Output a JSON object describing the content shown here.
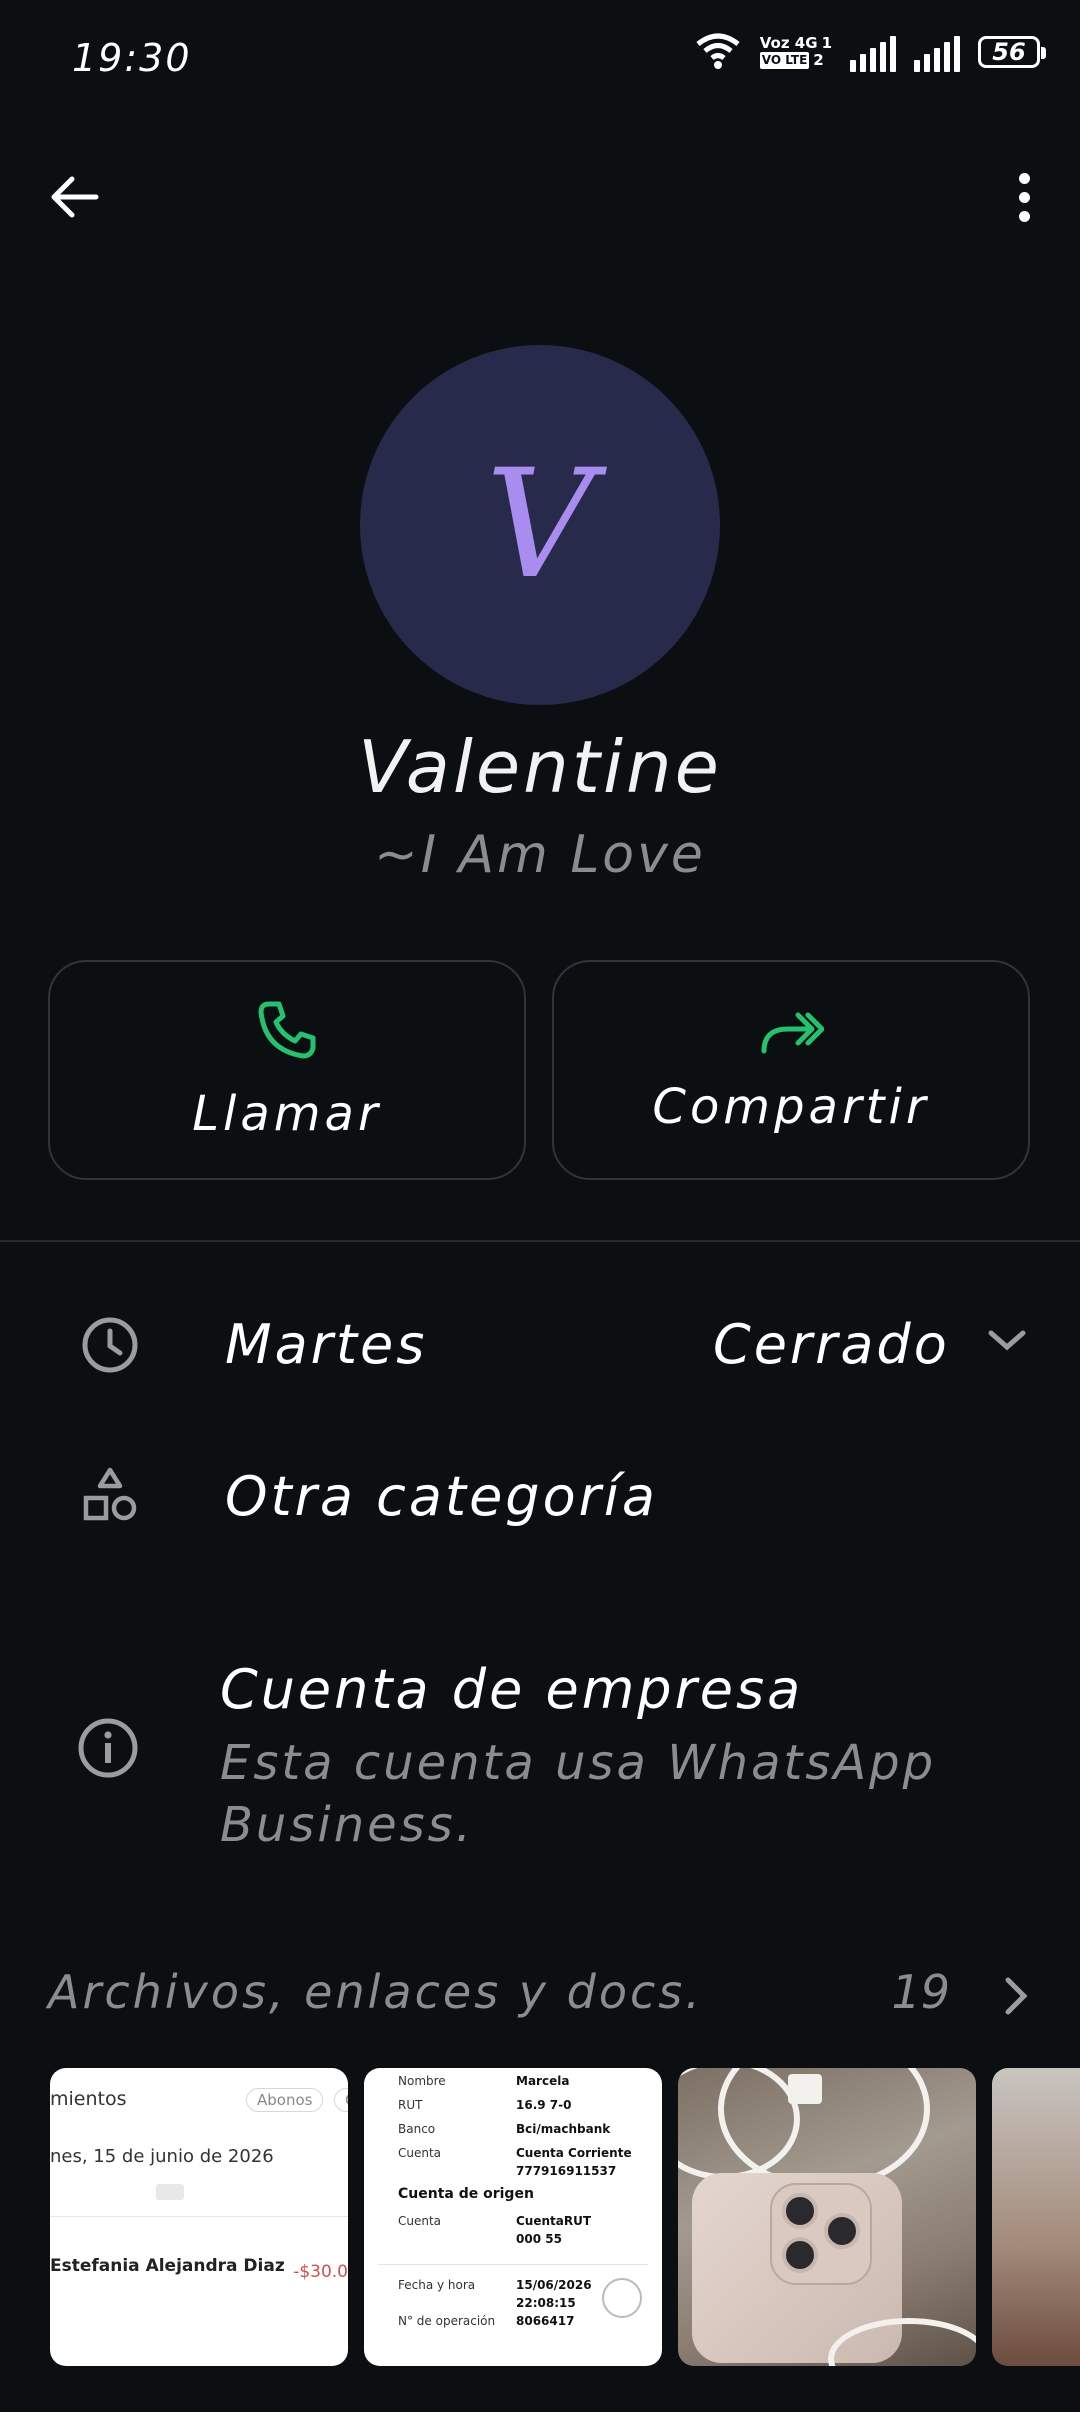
{
  "status_bar": {
    "time": "19:30",
    "sim1_label": "Voz 4G",
    "sim1_num": "1",
    "sim2_label": "VO LTE",
    "sim2_num": "2",
    "battery": "56"
  },
  "profile": {
    "avatar_letter": "V",
    "name": "Valentine",
    "about": "~I Am Love"
  },
  "actions": [
    {
      "label": "Llamar",
      "icon": "phone-icon",
      "color": "#25c16f"
    },
    {
      "label": "Compartir",
      "icon": "forward-icon",
      "color": "#25c16f"
    }
  ],
  "hours": {
    "day": "Martes",
    "status": "Cerrado"
  },
  "category": {
    "label": "Otra categoría"
  },
  "business": {
    "title": "Cuenta de empresa",
    "subtitle_line1": "Esta cuenta usa WhatsApp",
    "subtitle_line2": "Business."
  },
  "media": {
    "header": "Archivos, enlaces y docs.",
    "count": "19",
    "thumb1": {
      "header": "mientos",
      "pill1": "Abonos",
      "pill2": "C",
      "date": "nes, 15 de junio de 2026",
      "name": "Estefania Alejandra Diaz",
      "amount": "-$30.0"
    },
    "thumb2": {
      "rows": [
        {
          "k": "Nombre",
          "v": "Marcela"
        },
        {
          "k": "RUT",
          "v": "16.9      7-0"
        },
        {
          "k": "Banco",
          "v": "Bci/machbank"
        },
        {
          "k": "Cuenta",
          "v": "Cuenta Corriente"
        },
        {
          "k": "",
          "v": "777916911537"
        }
      ],
      "section": "Cuenta de origen",
      "origin_key": "Cuenta",
      "origin_val1": "CuentaRUT",
      "origin_val2": "000       55",
      "date_key": "Fecha y hora",
      "date_val": "15/06/2026",
      "time_val": "22:08:15",
      "op_key": "N° de operación",
      "op_val": "8066417"
    }
  },
  "colors": {
    "background": "#0b0f12",
    "accent": "#25c16f",
    "muted": "#8a8d90",
    "avatar_bg": "#272a4a",
    "avatar_fg": "#a98cf0"
  }
}
